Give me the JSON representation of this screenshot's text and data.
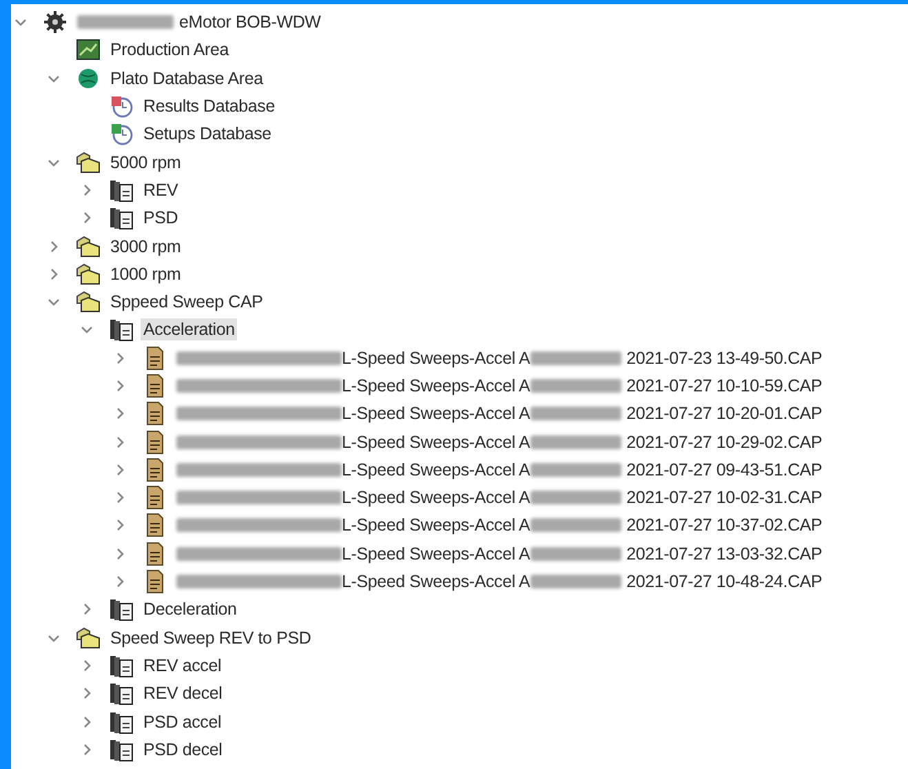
{
  "tree": [
    {
      "kind": "root",
      "label": [
        {
          "kind": "redacted"
        },
        {
          "kind": "text",
          "text": "eMotor BOB-WDW"
        }
      ],
      "expanded": true,
      "selected": false,
      "children": [
        {
          "kind": "area",
          "label": [
            {
              "kind": "text",
              "text": "Production Area"
            }
          ],
          "selected": false
        },
        {
          "kind": "database_area",
          "label": [
            {
              "kind": "text",
              "text": "Plato Database Area"
            }
          ],
          "expanded": true,
          "selected": false,
          "children": [
            {
              "kind": "results_db",
              "label": [
                {
                  "kind": "text",
                  "text": "Results Database"
                }
              ],
              "selected": false
            },
            {
              "kind": "setups_db",
              "label": [
                {
                  "kind": "text",
                  "text": "Setups Database"
                }
              ],
              "selected": false
            }
          ]
        },
        {
          "kind": "group",
          "label": [
            {
              "kind": "text",
              "text": "5000 rpm"
            }
          ],
          "expanded": true,
          "selected": false,
          "children": [
            {
              "kind": "set",
              "label": [
                {
                  "kind": "text",
                  "text": "REV"
                }
              ],
              "expanded": false,
              "selected": false
            },
            {
              "kind": "set",
              "label": [
                {
                  "kind": "text",
                  "text": "PSD"
                }
              ],
              "expanded": false,
              "selected": false
            }
          ]
        },
        {
          "kind": "group",
          "label": [
            {
              "kind": "text",
              "text": "3000 rpm"
            }
          ],
          "expanded": false,
          "selected": false
        },
        {
          "kind": "group",
          "label": [
            {
              "kind": "text",
              "text": "1000 rpm"
            }
          ],
          "expanded": false,
          "selected": false
        },
        {
          "kind": "group",
          "label": [
            {
              "kind": "text",
              "text": "Sppeed Sweep CAP"
            }
          ],
          "expanded": true,
          "selected": false,
          "children": [
            {
              "kind": "set",
              "label": [
                {
                  "kind": "text",
                  "text": "Acceleration"
                }
              ],
              "expanded": true,
              "selected": true,
              "children": [
                {
                  "kind": "file",
                  "label": [
                    {
                      "kind": "redacted"
                    },
                    {
                      "kind": "text",
                      "text": "L-Speed Sweeps-Accel A"
                    },
                    {
                      "kind": "redacted"
                    },
                    {
                      "kind": "text",
                      "text": "2021-07-23 13-49-50.CAP"
                    }
                  ],
                  "expanded": false,
                  "selected": false
                },
                {
                  "kind": "file",
                  "label": [
                    {
                      "kind": "redacted"
                    },
                    {
                      "kind": "text",
                      "text": "L-Speed Sweeps-Accel A"
                    },
                    {
                      "kind": "redacted"
                    },
                    {
                      "kind": "text",
                      "text": "2021-07-27 10-10-59.CAP"
                    }
                  ],
                  "expanded": false,
                  "selected": false
                },
                {
                  "kind": "file",
                  "label": [
                    {
                      "kind": "redacted"
                    },
                    {
                      "kind": "text",
                      "text": "L-Speed Sweeps-Accel A"
                    },
                    {
                      "kind": "redacted"
                    },
                    {
                      "kind": "text",
                      "text": "2021-07-27 10-20-01.CAP"
                    }
                  ],
                  "expanded": false,
                  "selected": false
                },
                {
                  "kind": "file",
                  "label": [
                    {
                      "kind": "redacted"
                    },
                    {
                      "kind": "text",
                      "text": "L-Speed Sweeps-Accel A"
                    },
                    {
                      "kind": "redacted"
                    },
                    {
                      "kind": "text",
                      "text": "2021-07-27 10-29-02.CAP"
                    }
                  ],
                  "expanded": false,
                  "selected": false
                },
                {
                  "kind": "file",
                  "label": [
                    {
                      "kind": "redacted"
                    },
                    {
                      "kind": "text",
                      "text": "L-Speed Sweeps-Accel A"
                    },
                    {
                      "kind": "redacted"
                    },
                    {
                      "kind": "text",
                      "text": "2021-07-27 09-43-51.CAP"
                    }
                  ],
                  "expanded": false,
                  "selected": false
                },
                {
                  "kind": "file",
                  "label": [
                    {
                      "kind": "redacted"
                    },
                    {
                      "kind": "text",
                      "text": "L-Speed Sweeps-Accel A"
                    },
                    {
                      "kind": "redacted"
                    },
                    {
                      "kind": "text",
                      "text": "2021-07-27 10-02-31.CAP"
                    }
                  ],
                  "expanded": false,
                  "selected": false
                },
                {
                  "kind": "file",
                  "label": [
                    {
                      "kind": "redacted"
                    },
                    {
                      "kind": "text",
                      "text": "L-Speed Sweeps-Accel A"
                    },
                    {
                      "kind": "redacted"
                    },
                    {
                      "kind": "text",
                      "text": "2021-07-27 10-37-02.CAP"
                    }
                  ],
                  "expanded": false,
                  "selected": false
                },
                {
                  "kind": "file",
                  "label": [
                    {
                      "kind": "redacted"
                    },
                    {
                      "kind": "text",
                      "text": "L-Speed Sweeps-Accel A"
                    },
                    {
                      "kind": "redacted"
                    },
                    {
                      "kind": "text",
                      "text": "2021-07-27 13-03-32.CAP"
                    }
                  ],
                  "expanded": false,
                  "selected": false
                },
                {
                  "kind": "file",
                  "label": [
                    {
                      "kind": "redacted"
                    },
                    {
                      "kind": "text",
                      "text": "L-Speed Sweeps-Accel A"
                    },
                    {
                      "kind": "redacted"
                    },
                    {
                      "kind": "text",
                      "text": "2021-07-27 10-48-24.CAP"
                    }
                  ],
                  "expanded": false,
                  "selected": false
                }
              ]
            },
            {
              "kind": "set",
              "label": [
                {
                  "kind": "text",
                  "text": "Deceleration"
                }
              ],
              "expanded": false,
              "selected": false
            }
          ]
        },
        {
          "kind": "group",
          "label": [
            {
              "kind": "text",
              "text": "Speed Sweep REV to PSD"
            }
          ],
          "expanded": true,
          "selected": false,
          "children": [
            {
              "kind": "set",
              "label": [
                {
                  "kind": "text",
                  "text": "REV accel"
                }
              ],
              "expanded": false,
              "selected": false
            },
            {
              "kind": "set",
              "label": [
                {
                  "kind": "text",
                  "text": "REV decel"
                }
              ],
              "expanded": false,
              "selected": false
            },
            {
              "kind": "set",
              "label": [
                {
                  "kind": "text",
                  "text": "PSD accel"
                }
              ],
              "expanded": false,
              "selected": false
            },
            {
              "kind": "set",
              "label": [
                {
                  "kind": "text",
                  "text": "PSD decel"
                }
              ],
              "expanded": false,
              "selected": false
            }
          ]
        }
      ]
    }
  ]
}
